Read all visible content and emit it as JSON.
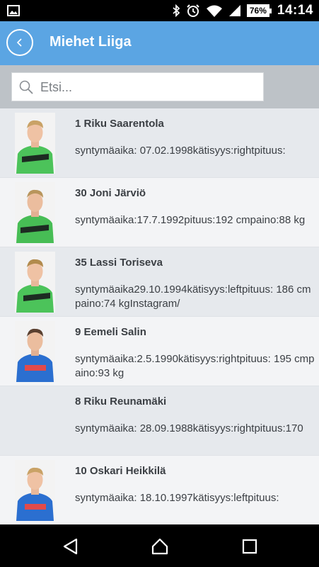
{
  "status_bar": {
    "time": "14:14",
    "battery": "76%",
    "icons": [
      "image-icon",
      "bluetooth-icon",
      "alarm-icon",
      "wifi-icon",
      "signal-icon",
      "battery-icon"
    ]
  },
  "header": {
    "title": "Miehet Liiga",
    "back_icon": "chevron-left-icon",
    "color": "#5ba5e3"
  },
  "search": {
    "placeholder": "Etsi...",
    "value": ""
  },
  "players": [
    {
      "name": "1 Riku Saarentola",
      "info": "syntymäaika: 07.02.1998kätisyys:rightpituus:",
      "photo": "goalie-green"
    },
    {
      "name": "30 Joni Järviö",
      "info": "syntymäaika:17.7.1992pituus:192 cmpaino:88 kg",
      "photo": "goalie-green"
    },
    {
      "name": "35 Lassi Toriseva",
      "info": " syntymäaika29.10.1994kätisyys:leftpituus: 186 cmpaino:74 kgInstagram/",
      "photo": "goalie-green"
    },
    {
      "name": "9 Eemeli Salin",
      "info": "   syntymäaika:2.5.1990kätisyys:rightpituus: 195 cmpaino:93 kg",
      "photo": "blue"
    },
    {
      "name": "8 Riku Reunamäki",
      "info": "syntymäaika: 28.09.1988kätisyys:rightpituus:170",
      "photo": "none"
    },
    {
      "name": "10 Oskari Heikkilä",
      "info": "   syntymäaika: 18.10.1997kätisyys:leftpituus:",
      "photo": "blue"
    }
  ],
  "nav_bar": {
    "icons": [
      "back-triangle-icon",
      "home-icon",
      "recents-square-icon"
    ]
  }
}
